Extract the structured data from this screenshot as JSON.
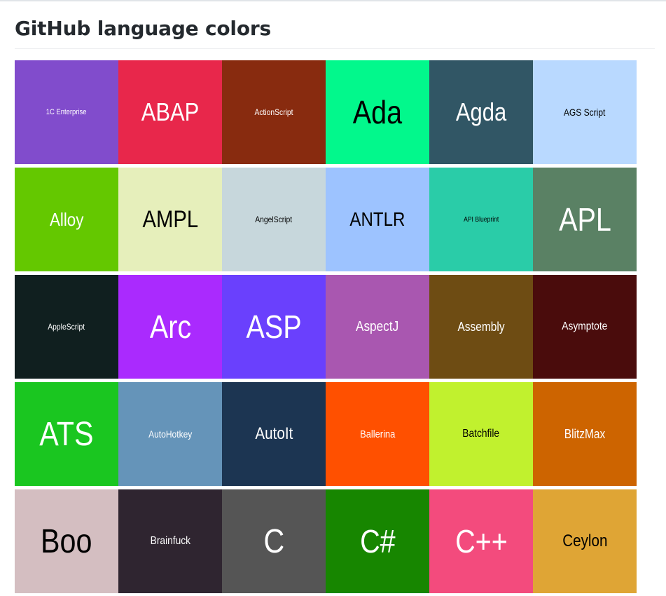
{
  "page": {
    "title": "GitHub language colors"
  },
  "languages": [
    {
      "name": "1C Enterprise",
      "color": "#814CCC",
      "text": "#ffffff",
      "size": 11
    },
    {
      "name": "ABAP",
      "color": "#E8274B",
      "text": "#ffffff",
      "size": 36
    },
    {
      "name": "ActionScript",
      "color": "#882B0F",
      "text": "#ffffff",
      "size": 12
    },
    {
      "name": "Ada",
      "color": "#02F88C",
      "text": "#000000",
      "size": 46
    },
    {
      "name": "Agda",
      "color": "#315665",
      "text": "#ffffff",
      "size": 36
    },
    {
      "name": "AGS Script",
      "color": "#B9D9FF",
      "text": "#000000",
      "size": 14
    },
    {
      "name": "Alloy",
      "color": "#64C800",
      "text": "#ffffff",
      "size": 26
    },
    {
      "name": "AMPL",
      "color": "#E6EFBB",
      "text": "#000000",
      "size": 34
    },
    {
      "name": "AngelScript",
      "color": "#C7D7DC",
      "text": "#000000",
      "size": 12
    },
    {
      "name": "ANTLR",
      "color": "#9DC3FF",
      "text": "#000000",
      "size": 28
    },
    {
      "name": "API Blueprint",
      "color": "#2ACCA8",
      "text": "#000000",
      "size": 10
    },
    {
      "name": "APL",
      "color": "#5A8164",
      "text": "#ffffff",
      "size": 46
    },
    {
      "name": "AppleScript",
      "color": "#101F1F",
      "text": "#ffffff",
      "size": 12
    },
    {
      "name": "Arc",
      "color": "#AA2AFE",
      "text": "#ffffff",
      "size": 46
    },
    {
      "name": "ASP",
      "color": "#6A40FD",
      "text": "#ffffff",
      "size": 46
    },
    {
      "name": "AspectJ",
      "color": "#A957B0",
      "text": "#ffffff",
      "size": 20
    },
    {
      "name": "Assembly",
      "color": "#6E4C13",
      "text": "#ffffff",
      "size": 18
    },
    {
      "name": "Asymptote",
      "color": "#4A0C0C",
      "text": "#ffffff",
      "size": 16
    },
    {
      "name": "ATS",
      "color": "#1AC620",
      "text": "#ffffff",
      "size": 48
    },
    {
      "name": "AutoHotkey",
      "color": "#6594B9",
      "text": "#ffffff",
      "size": 14
    },
    {
      "name": "AutoIt",
      "color": "#1C3552",
      "text": "#ffffff",
      "size": 24
    },
    {
      "name": "Ballerina",
      "color": "#FF5000",
      "text": "#ffffff",
      "size": 15
    },
    {
      "name": "Batchfile",
      "color": "#C1F12E",
      "text": "#000000",
      "size": 16
    },
    {
      "name": "BlitzMax",
      "color": "#CD6400",
      "text": "#ffffff",
      "size": 18
    },
    {
      "name": "Boo",
      "color": "#D4BEC1",
      "text": "#000000",
      "size": 48
    },
    {
      "name": "Brainfuck",
      "color": "#2F2530",
      "text": "#ffffff",
      "size": 16
    },
    {
      "name": "C",
      "color": "#555555",
      "text": "#ffffff",
      "size": 48
    },
    {
      "name": "C#",
      "color": "#178600",
      "text": "#ffffff",
      "size": 46
    },
    {
      "name": "C++",
      "color": "#F34B7D",
      "text": "#ffffff",
      "size": 46
    },
    {
      "name": "Ceylon",
      "color": "#DFA535",
      "text": "#000000",
      "size": 24
    }
  ]
}
